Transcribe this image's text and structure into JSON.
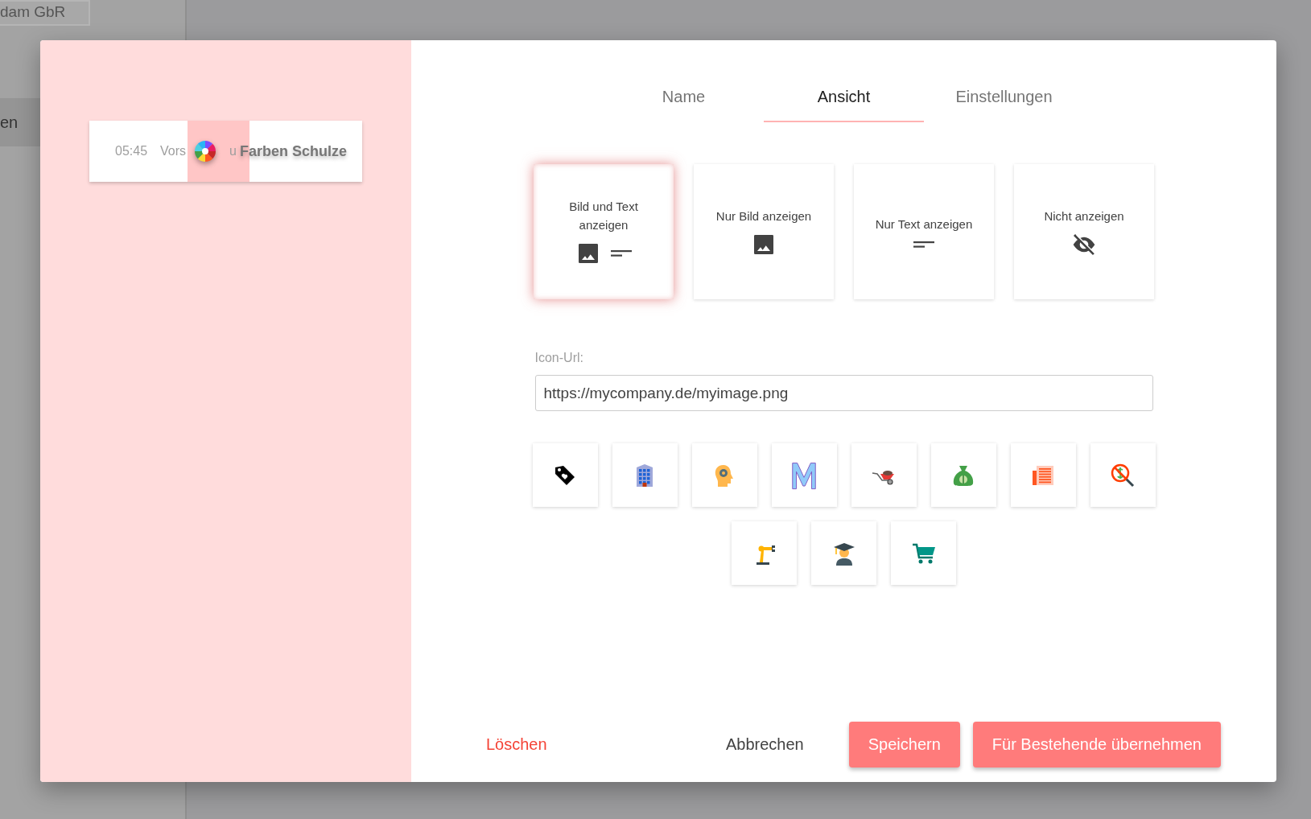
{
  "background": {
    "company_label": "dam GbR",
    "sidebar_label": "en"
  },
  "preview": {
    "time": "05:45",
    "label_start": "Vors",
    "label_end": "u",
    "title": "Farben Schulze"
  },
  "tabs": [
    {
      "label": "Name",
      "selected": false
    },
    {
      "label": "Ansicht",
      "selected": true
    },
    {
      "label": "Einstellungen",
      "selected": false
    }
  ],
  "display_modes": [
    {
      "kind": "image_text",
      "label": "Bild und Text anzeigen",
      "selected": true
    },
    {
      "kind": "image",
      "label": "Nur Bild anzeigen",
      "selected": false
    },
    {
      "kind": "text",
      "label": "Nur Text anzeigen",
      "selected": false
    },
    {
      "kind": "hidden",
      "label": "Nicht anzeigen",
      "selected": false
    }
  ],
  "icon_url": {
    "label": "Icon-Url:",
    "value": "https://mycompany.de/myimage.png"
  },
  "icon_tiles": [
    {
      "kind": "tag"
    },
    {
      "kind": "building"
    },
    {
      "kind": "head"
    },
    {
      "kind": "letter"
    },
    {
      "kind": "wheelbarrow"
    },
    {
      "kind": "moneybag"
    },
    {
      "kind": "newspaper"
    },
    {
      "kind": "nomoney"
    },
    {
      "kind": "robot"
    },
    {
      "kind": "graduate"
    },
    {
      "kind": "cart"
    }
  ],
  "footer": {
    "delete": "Löschen",
    "cancel": "Abbrechen",
    "save": "Speichern",
    "apply": "Für Bestehende übernehmen"
  }
}
